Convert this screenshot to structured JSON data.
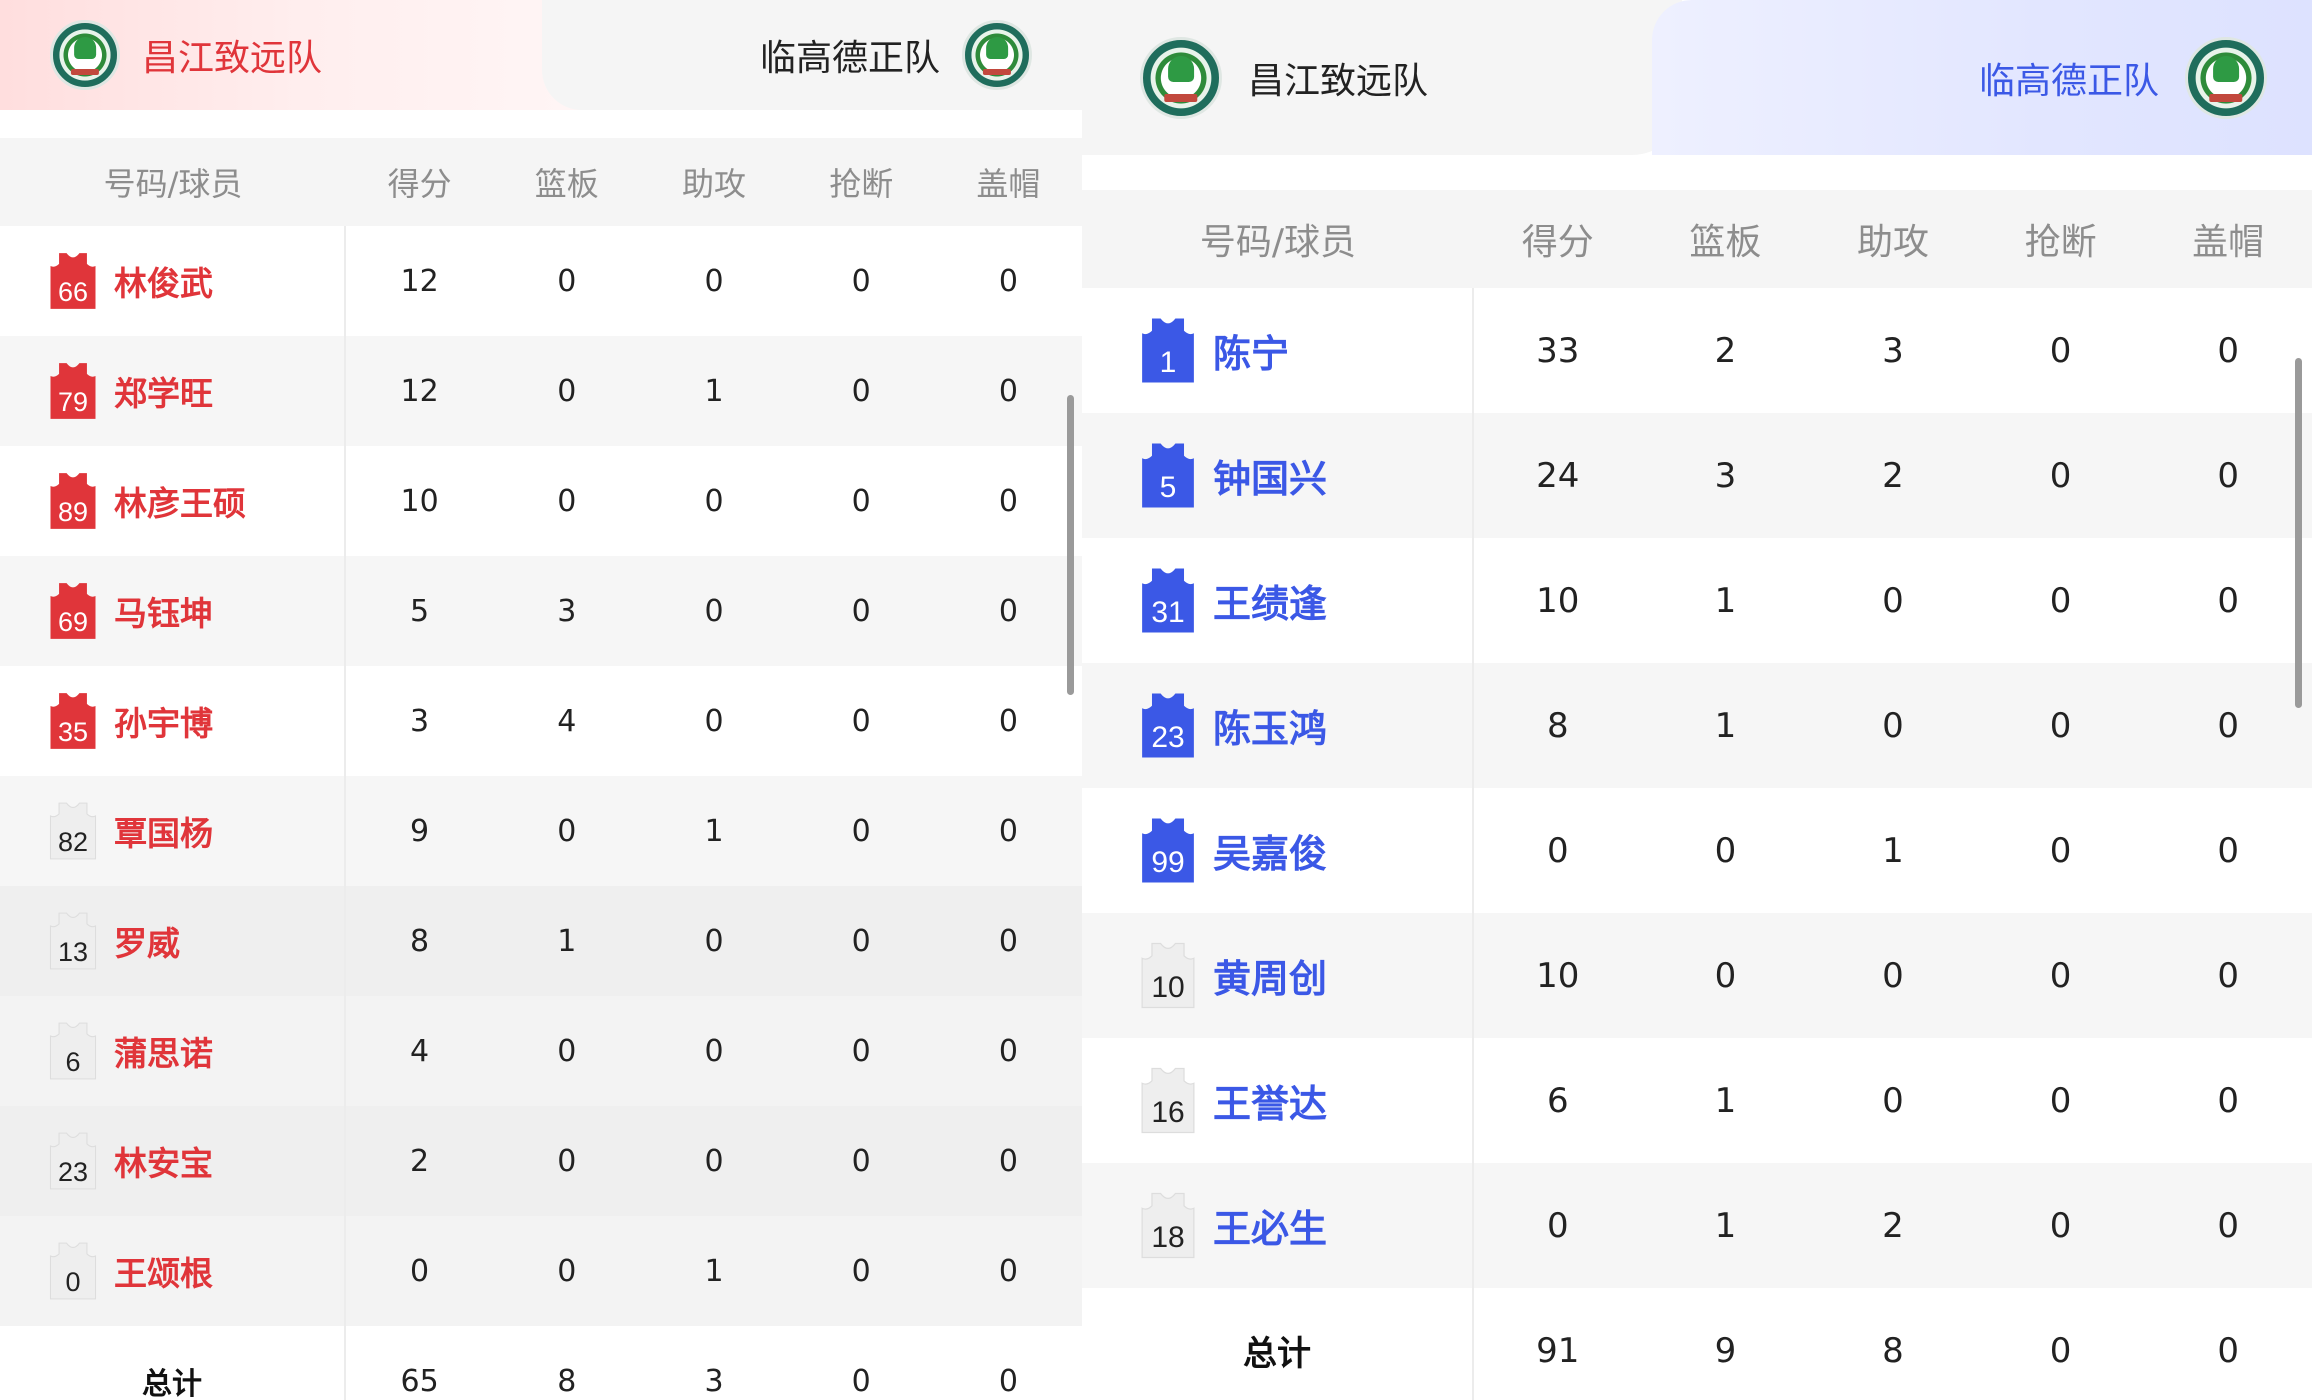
{
  "left": {
    "home_team": "昌江致远队",
    "away_team": "临高德正队",
    "headers": [
      "号码/球员",
      "得分",
      "篮板",
      "助攻",
      "抢断",
      "盖帽"
    ],
    "players": [
      {
        "number": "66",
        "name": "林俊武",
        "stats": [
          "12",
          "0",
          "0",
          "0",
          "0"
        ],
        "starter": true
      },
      {
        "number": "79",
        "name": "郑学旺",
        "stats": [
          "12",
          "0",
          "1",
          "0",
          "0"
        ],
        "starter": true
      },
      {
        "number": "89",
        "name": "林彦王硕",
        "stats": [
          "10",
          "0",
          "0",
          "0",
          "0"
        ],
        "starter": true
      },
      {
        "number": "69",
        "name": "马钰坤",
        "stats": [
          "5",
          "3",
          "0",
          "0",
          "0"
        ],
        "starter": true
      },
      {
        "number": "35",
        "name": "孙宇博",
        "stats": [
          "3",
          "4",
          "0",
          "0",
          "0"
        ],
        "starter": true
      },
      {
        "number": "82",
        "name": "覃国杨",
        "stats": [
          "9",
          "0",
          "1",
          "0",
          "0"
        ],
        "starter": false
      },
      {
        "number": "13",
        "name": "罗威",
        "stats": [
          "8",
          "1",
          "0",
          "0",
          "0"
        ],
        "starter": false
      },
      {
        "number": "6",
        "name": "蒲思诺",
        "stats": [
          "4",
          "0",
          "0",
          "0",
          "0"
        ],
        "starter": false
      },
      {
        "number": "23",
        "name": "林安宝",
        "stats": [
          "2",
          "0",
          "0",
          "0",
          "0"
        ],
        "starter": false
      },
      {
        "number": "0",
        "name": "王颂根",
        "stats": [
          "0",
          "0",
          "1",
          "0",
          "0"
        ],
        "starter": false
      }
    ],
    "total": {
      "label": "总计",
      "stats": [
        "65",
        "8",
        "3",
        "0",
        "0"
      ]
    }
  },
  "right": {
    "home_team": "昌江致远队",
    "away_team": "临高德正队",
    "headers": [
      "号码/球员",
      "得分",
      "篮板",
      "助攻",
      "抢断",
      "盖帽"
    ],
    "players": [
      {
        "number": "1",
        "name": "陈宁",
        "stats": [
          "33",
          "2",
          "3",
          "0",
          "0"
        ],
        "starter": true
      },
      {
        "number": "5",
        "name": "钟国兴",
        "stats": [
          "24",
          "3",
          "2",
          "0",
          "0"
        ],
        "starter": true
      },
      {
        "number": "31",
        "name": "王绩逢",
        "stats": [
          "10",
          "1",
          "0",
          "0",
          "0"
        ],
        "starter": true
      },
      {
        "number": "23",
        "name": "陈玉鸿",
        "stats": [
          "8",
          "1",
          "0",
          "0",
          "0"
        ],
        "starter": true
      },
      {
        "number": "99",
        "name": "吴嘉俊",
        "stats": [
          "0",
          "0",
          "1",
          "0",
          "0"
        ],
        "starter": true
      },
      {
        "number": "10",
        "name": "黄周创",
        "stats": [
          "10",
          "0",
          "0",
          "0",
          "0"
        ],
        "starter": false
      },
      {
        "number": "16",
        "name": "王誉达",
        "stats": [
          "6",
          "1",
          "0",
          "0",
          "0"
        ],
        "starter": false
      },
      {
        "number": "18",
        "name": "王必生",
        "stats": [
          "0",
          "1",
          "2",
          "0",
          "0"
        ],
        "starter": false
      }
    ],
    "total": {
      "label": "总计",
      "stats": [
        "91",
        "9",
        "8",
        "0",
        "0"
      ]
    }
  },
  "colors": {
    "home_accent": "#e0353a",
    "away_accent": "#3b58e6",
    "bench_jersey": "#eeeeee",
    "header_bg": "#f5f5f5"
  }
}
